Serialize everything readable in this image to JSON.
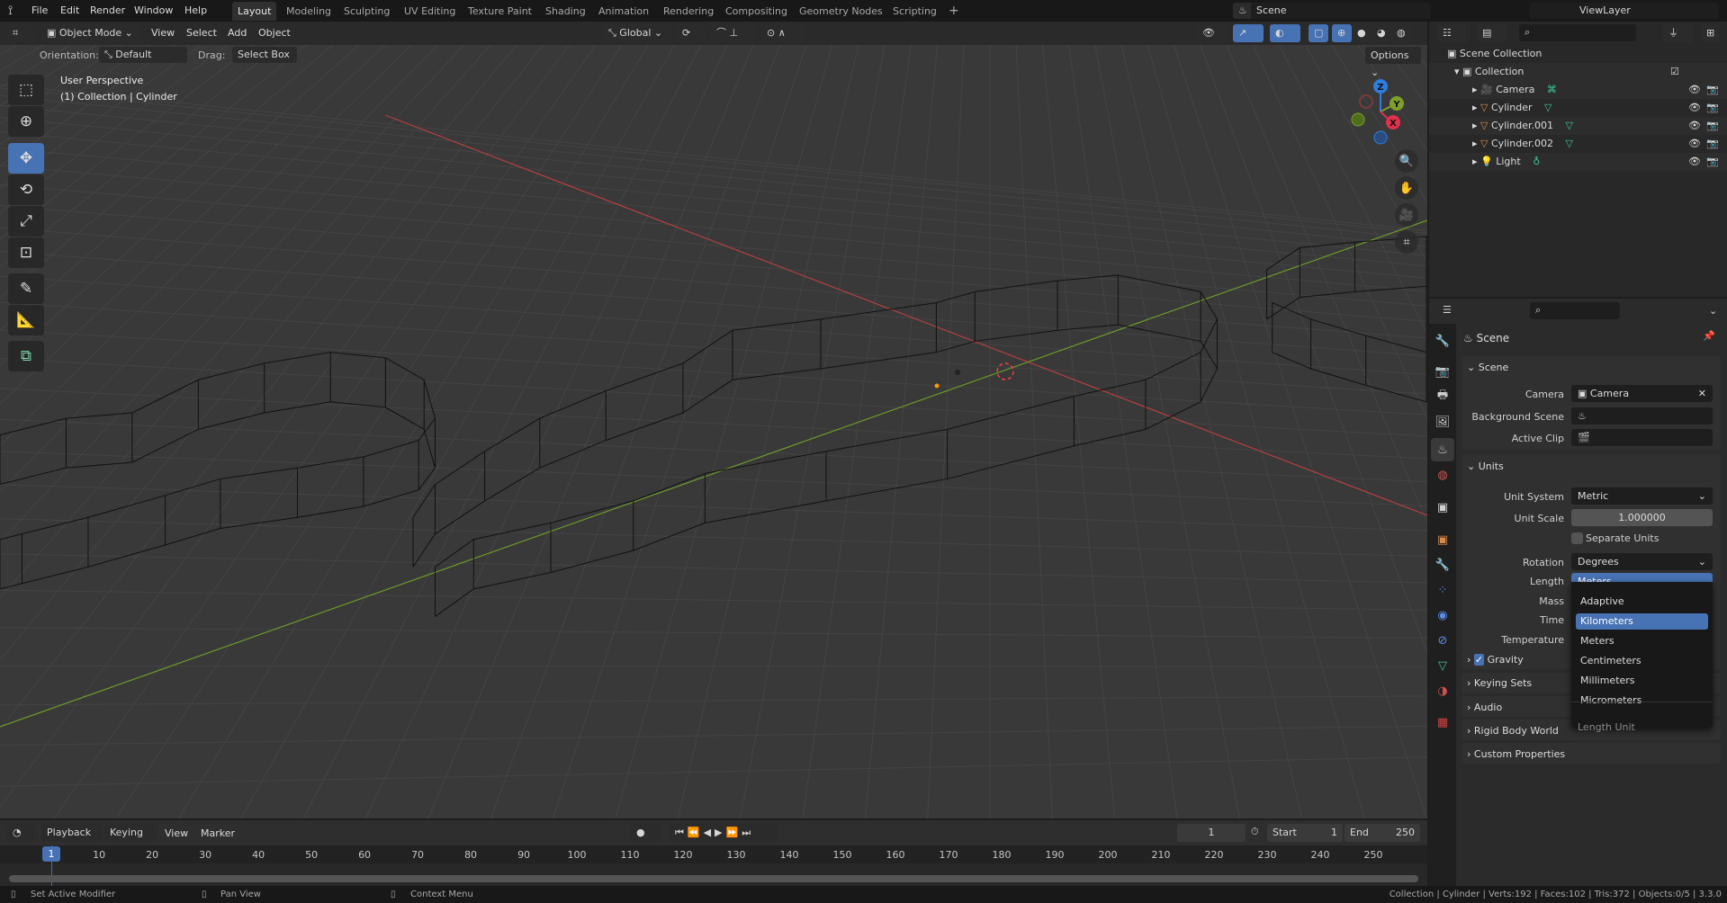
{
  "menubar": {
    "items": [
      "File",
      "Edit",
      "Render",
      "Window",
      "Help"
    ],
    "workspaces": [
      "Layout",
      "Modeling",
      "Sculpting",
      "UV Editing",
      "Texture Paint",
      "Shading",
      "Animation",
      "Rendering",
      "Compositing",
      "Geometry Nodes",
      "Scripting"
    ],
    "active_workspace": "Layout",
    "add_tab": "+",
    "scene": "Scene",
    "view_layer": "ViewLayer"
  },
  "viewport_header": {
    "mode": "Object Mode",
    "menus": [
      "View",
      "Select",
      "Add",
      "Object"
    ],
    "transform_orientation": "Global",
    "orientation_label": "Orientation:",
    "orientation_value": "Default",
    "drag_label": "Drag:",
    "drag_value": "Select Box",
    "options": "Options"
  },
  "viewport": {
    "view_name": "User Perspective",
    "context": "(1) Collection | Cylinder",
    "gizmo": {
      "z": "Z",
      "y": "Y",
      "x": "X"
    },
    "colors": {
      "x_axis": "#b3403f",
      "y_axis": "#6e9a2a",
      "background": "#393939",
      "wire": "#111111"
    }
  },
  "tools": [
    "select-box",
    "cursor",
    "move",
    "rotate",
    "scale",
    "transform",
    "annotate",
    "measure",
    "add-cube"
  ],
  "active_tool": "move",
  "outliner": {
    "root": "Scene Collection",
    "collection": "Collection",
    "items": [
      {
        "name": "Camera",
        "type": "camera"
      },
      {
        "name": "Cylinder",
        "type": "mesh"
      },
      {
        "name": "Cylinder.001",
        "type": "mesh"
      },
      {
        "name": "Cylinder.002",
        "type": "mesh"
      },
      {
        "name": "Light",
        "type": "light"
      }
    ]
  },
  "properties": {
    "context": "Scene",
    "scene_panel": {
      "title": "Scene",
      "camera_label": "Camera",
      "camera_value": "Camera",
      "background_label": "Background Scene",
      "clip_label": "Active Clip"
    },
    "units_panel": {
      "title": "Units",
      "unit_system_label": "Unit System",
      "unit_system": "Metric",
      "unit_scale_label": "Unit Scale",
      "unit_scale": "1.000000",
      "separate_units": "Separate Units",
      "rotation_label": "Rotation",
      "rotation": "Degrees",
      "length_label": "Length",
      "length": "Meters",
      "mass_label": "Mass",
      "time_label": "Time",
      "temperature_label": "Temperature"
    },
    "collapsed_panels": [
      "Gravity",
      "Keying Sets",
      "Audio",
      "Rigid Body World",
      "Custom Properties"
    ],
    "gravity_checked": true
  },
  "length_dropdown": {
    "options": [
      "Adaptive",
      "Kilometers",
      "Meters",
      "Centimeters",
      "Millimeters",
      "Micrometers"
    ],
    "highlighted": "Kilometers",
    "title": "Length Unit"
  },
  "timeline": {
    "menus": [
      "Playback",
      "Keying",
      "View",
      "Marker"
    ],
    "current_frame": "1",
    "start_label": "Start",
    "start": "1",
    "end_label": "End",
    "end": "250",
    "ticks": [
      "1",
      "10",
      "20",
      "30",
      "40",
      "50",
      "60",
      "70",
      "80",
      "90",
      "100",
      "110",
      "120",
      "130",
      "140",
      "150",
      "160",
      "170",
      "180",
      "190",
      "200",
      "210",
      "220",
      "230",
      "240",
      "250"
    ]
  },
  "statusbar": {
    "left": "Set Active Modifier",
    "middle": "Pan View",
    "right_hint": "Context Menu",
    "stats": "Collection | Cylinder | Verts:192 | Faces:102 | Tris:372 | Objects:0/5 | 3.3.0"
  },
  "accent": "#4772b3"
}
